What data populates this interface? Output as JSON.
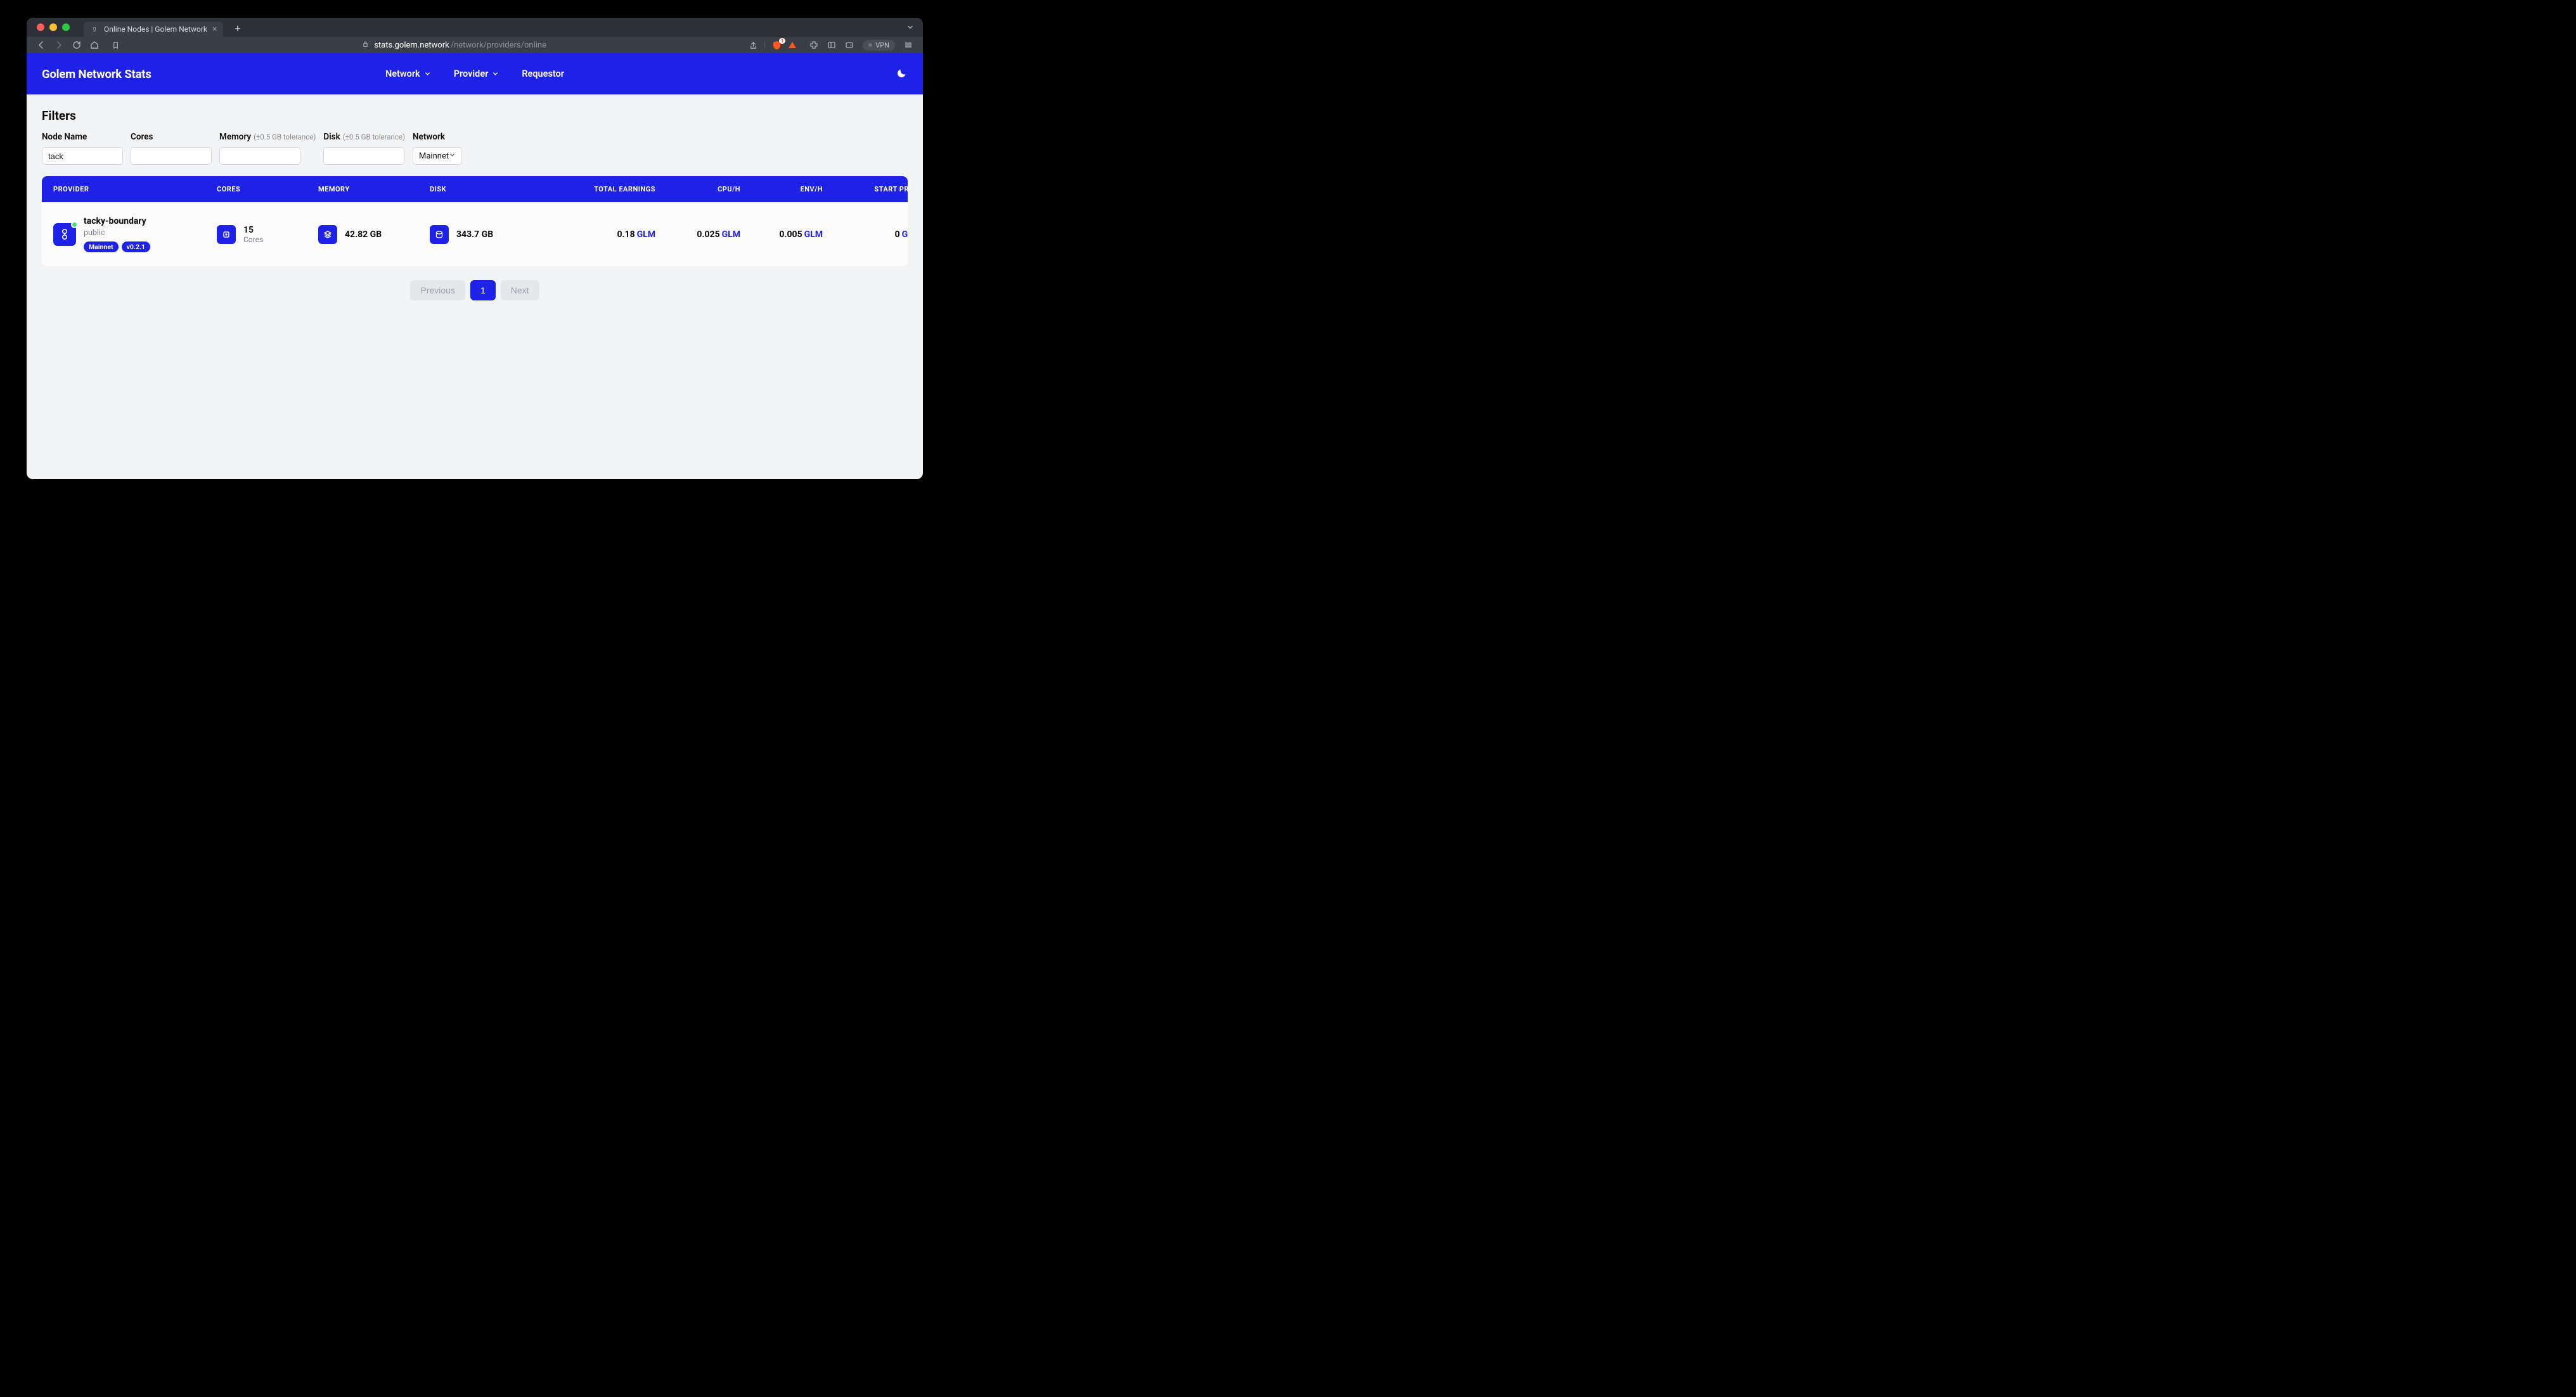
{
  "browser": {
    "tab_title": "Online Nodes | Golem Network",
    "url_host": "stats.golem.network",
    "url_path": "/network/providers/online",
    "vpn_label": "VPN",
    "shield_count": "1"
  },
  "header": {
    "brand": "Golem Network Stats",
    "nav": {
      "network": "Network",
      "provider": "Provider",
      "requestor": "Requestor"
    }
  },
  "filters": {
    "title": "Filters",
    "node_name": {
      "label": "Node Name",
      "value": "tack"
    },
    "cores": {
      "label": "Cores",
      "value": ""
    },
    "memory": {
      "label": "Memory",
      "sublabel": "(±0.5 GB tolerance)",
      "value": ""
    },
    "disk": {
      "label": "Disk",
      "sublabel": "(±0.5 GB tolerance)",
      "value": ""
    },
    "network": {
      "label": "Network",
      "selected": "Mainnet"
    }
  },
  "table": {
    "headers": {
      "provider": "PROVIDER",
      "cores": "CORES",
      "memory": "MEMORY",
      "disk": "DISK",
      "total_earnings": "TOTAL EARNINGS",
      "cpu_h": "CPU/H",
      "env_h": "ENV/H",
      "start_price": "START PRICE"
    },
    "rows": [
      {
        "name": "tacky-boundary",
        "subnet": "public",
        "badges": [
          "Mainnet",
          "v0.2.1"
        ],
        "cores": "15",
        "cores_sub": "Cores",
        "memory": "42.82 GB",
        "disk": "343.7 GB",
        "total_earnings": "0.18",
        "cpu_h": "0.025",
        "env_h": "0.005",
        "start_price": "0",
        "currency": "GLM"
      }
    ]
  },
  "pagination": {
    "previous": "Previous",
    "next": "Next",
    "current": "1"
  }
}
